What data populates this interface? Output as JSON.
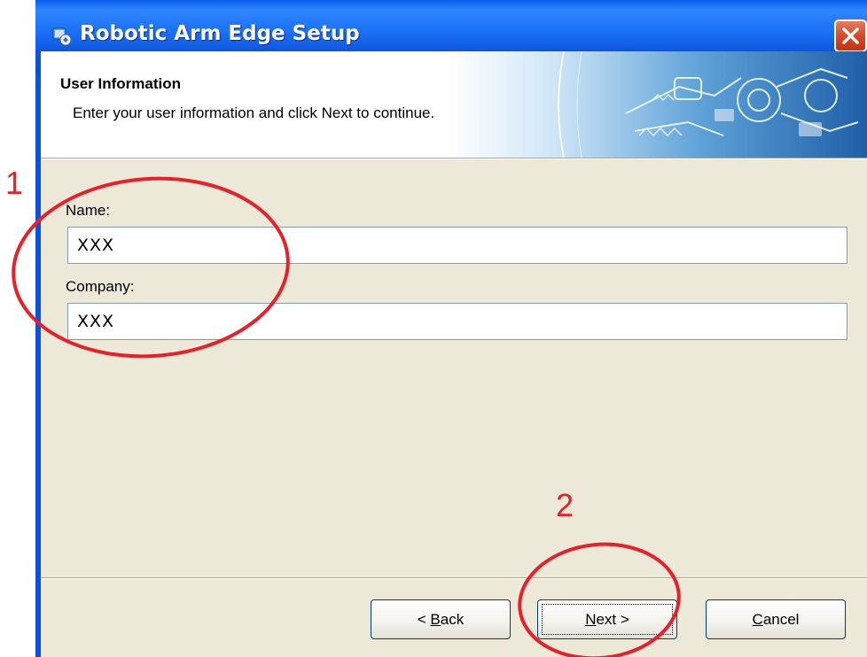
{
  "window": {
    "title": "Robotic Arm Edge Setup"
  },
  "header": {
    "title": "User Information",
    "subtitle": "Enter your user information and click Next to continue."
  },
  "form": {
    "name_label": "Name:",
    "name_value": "XXX",
    "company_label": "Company:",
    "company_value": "XXX"
  },
  "buttons": {
    "back_prefix": "< ",
    "back_key": "B",
    "back_rest": "ack",
    "next_key": "N",
    "next_rest": "ext >",
    "cancel_key": "C",
    "cancel_rest": "ancel"
  },
  "annotations": {
    "step1": "1",
    "step2": "2",
    "color": "#e8202a"
  },
  "icons": {
    "title_icon": "setup-icon",
    "close_icon": "close-icon",
    "banner_art": "robotic-arm-illustration"
  },
  "colors": {
    "titlebar": "#0b52d8",
    "client_bg": "#ece9d8",
    "close_btn": "#d8492b"
  }
}
